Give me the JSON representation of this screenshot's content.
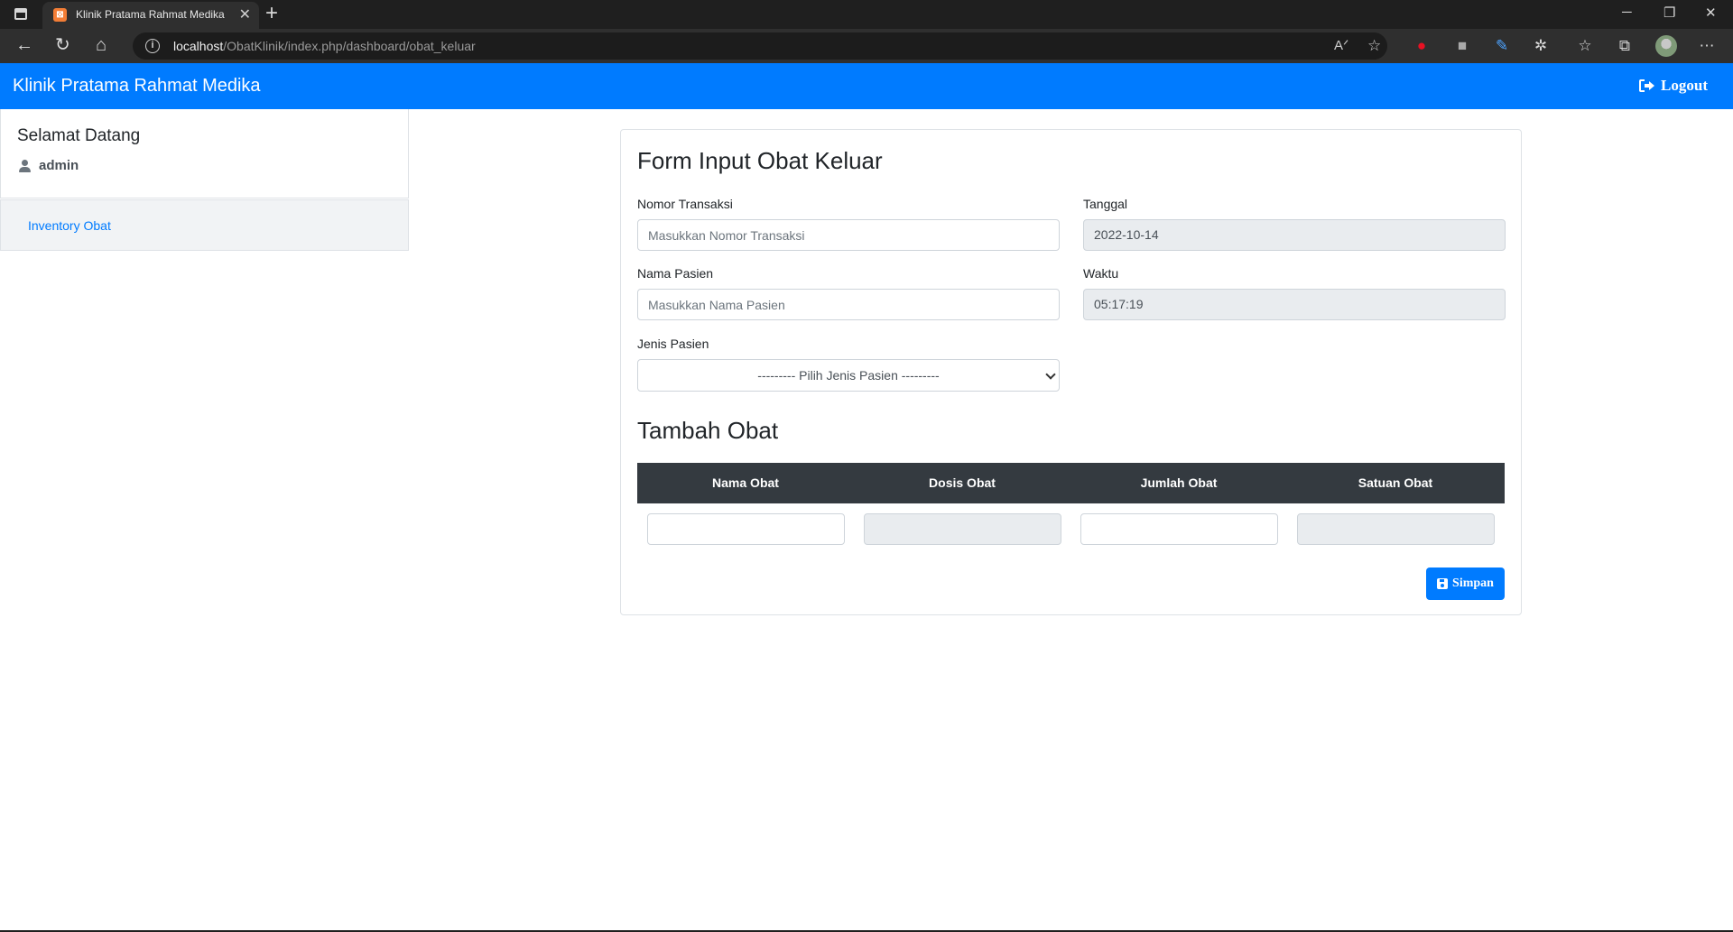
{
  "browser": {
    "tab_title": "Klinik Pratama Rahmat Medika",
    "url_host": "localhost",
    "url_path": "/ObatKlinik/index.php/dashboard/obat_keluar"
  },
  "navbar": {
    "brand": "Klinik Pratama Rahmat Medika",
    "logout_label": "Logout",
    "color": "#007bff"
  },
  "sidebar": {
    "welcome": "Selamat Datang",
    "username": "admin",
    "menu_item": "Inventory Obat"
  },
  "form": {
    "title": "Form Input Obat Keluar",
    "nomor_label": "Nomor Transaksi",
    "nomor_placeholder": "Masukkan Nomor Transaksi",
    "tanggal_label": "Tanggal",
    "tanggal_value": "2022-10-14",
    "nama_label": "Nama Pasien",
    "nama_placeholder": "Masukkan Nama Pasien",
    "waktu_label": "Waktu",
    "waktu_value": "05:17:19",
    "jenis_label": "Jenis Pasien",
    "jenis_selected": "--------- Pilih Jenis Pasien ---------"
  },
  "obat": {
    "title": "Tambah Obat",
    "columns": [
      "Nama Obat",
      "Dosis Obat",
      "Jumlah Obat",
      "Satuan Obat"
    ],
    "save_label": "Simpan"
  }
}
